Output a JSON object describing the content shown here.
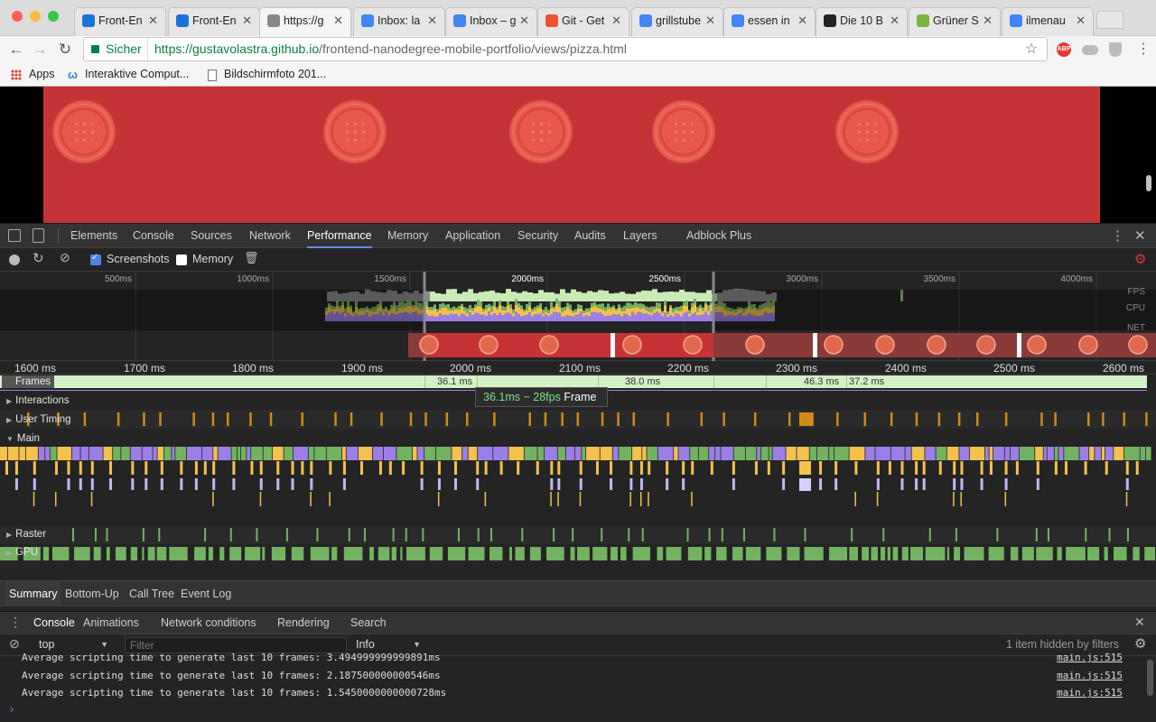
{
  "browser": {
    "tabs": [
      {
        "title": "Front-En",
        "icon": "udacity-icon",
        "color": "#1a73d9",
        "active": false
      },
      {
        "title": "Front-En",
        "icon": "udacity-icon",
        "color": "#1a73d9",
        "active": false
      },
      {
        "title": "https://g",
        "icon": "page-icon",
        "color": "#888888",
        "active": true
      },
      {
        "title": "Inbox: la",
        "icon": "inbox-icon",
        "color": "#4285f4",
        "active": false
      },
      {
        "title": "Inbox – g",
        "icon": "inbox-icon",
        "color": "#4285f4",
        "active": false
      },
      {
        "title": "Git - Get",
        "icon": "git-icon",
        "color": "#f05133",
        "active": false
      },
      {
        "title": "grillstube",
        "icon": "google-icon",
        "color": "#4285f4",
        "active": false
      },
      {
        "title": "essen in",
        "icon": "google-icon",
        "color": "#4285f4",
        "active": false
      },
      {
        "title": "Die 10 B",
        "icon": "tripadvisor-icon",
        "color": "#222222",
        "active": false
      },
      {
        "title": "Grüner S",
        "icon": "leaf-icon",
        "color": "#7cb342",
        "active": false
      },
      {
        "title": "ilmenau",
        "icon": "google-icon",
        "color": "#4285f4",
        "active": false
      }
    ],
    "secure_label": "Sicher",
    "url_host": "https://gustavolastra.github.io",
    "url_path": "/frontend-nanodegree-mobile-portfolio/views/pizza.html",
    "bookmarks": [
      "Apps",
      "Interaktive Comput...",
      "Bildschirmfoto 201..."
    ]
  },
  "devtools": {
    "tabs": [
      "Elements",
      "Console",
      "Sources",
      "Network",
      "Performance",
      "Memory",
      "Application",
      "Security",
      "Audits",
      "Layers",
      "Adblock Plus"
    ],
    "selected_tab": "Performance",
    "perf_toolbar": {
      "screenshots_label": "Screenshots",
      "memory_label": "Memory",
      "screenshots_checked": true,
      "memory_checked": false
    },
    "overview": {
      "ticks": [
        "500ms",
        "1000ms",
        "1500ms",
        "2000ms",
        "2500ms",
        "3000ms",
        "3500ms",
        "4000ms"
      ],
      "lanes": [
        "FPS",
        "CPU",
        "NET"
      ]
    },
    "ruler_ticks": [
      "1600 ms",
      "1700 ms",
      "1800 ms",
      "1900 ms",
      "2000 ms",
      "2100 ms",
      "2200 ms",
      "2300 ms",
      "2400 ms",
      "2500 ms",
      "2600 ms"
    ],
    "frames_label": "Frames",
    "frame_durations": [
      "36.1 ms",
      "38.0 ms",
      "46.3 ms",
      "37.2 ms"
    ],
    "tooltip": {
      "value": "36.1ms ~ 28fps",
      "label": "Frame"
    },
    "tracks": [
      "Interactions",
      "User Timing",
      "Main",
      "Raster",
      "GPU"
    ],
    "bottom_tabs": [
      "Summary",
      "Bottom-Up",
      "Call Tree",
      "Event Log"
    ],
    "drawer_tabs": [
      "Console",
      "Animations",
      "Network conditions",
      "Rendering",
      "Search"
    ],
    "console_toolbar": {
      "context": "top",
      "filter_placeholder": "Filter",
      "level": "Info",
      "hidden_text": "1 item hidden by filters"
    },
    "console_lines": [
      {
        "text": "Average scripting time to generate last 10 frames: 3.494999999999891ms",
        "source": "main.js:515"
      },
      {
        "text": "Average scripting time to generate last 10 frames: 2.187500000000546ms",
        "source": "main.js:515"
      },
      {
        "text": "Average scripting time to generate last 10 frames: 1.5450000000000728ms",
        "source": "main.js:515"
      }
    ],
    "prompt_symbol": "›"
  },
  "colors": {
    "scripting": "#f2c14e",
    "rendering": "#9b7fe6",
    "painting": "#72b260",
    "frames": "#d3f1c5",
    "accent": "#5d8ff0"
  }
}
